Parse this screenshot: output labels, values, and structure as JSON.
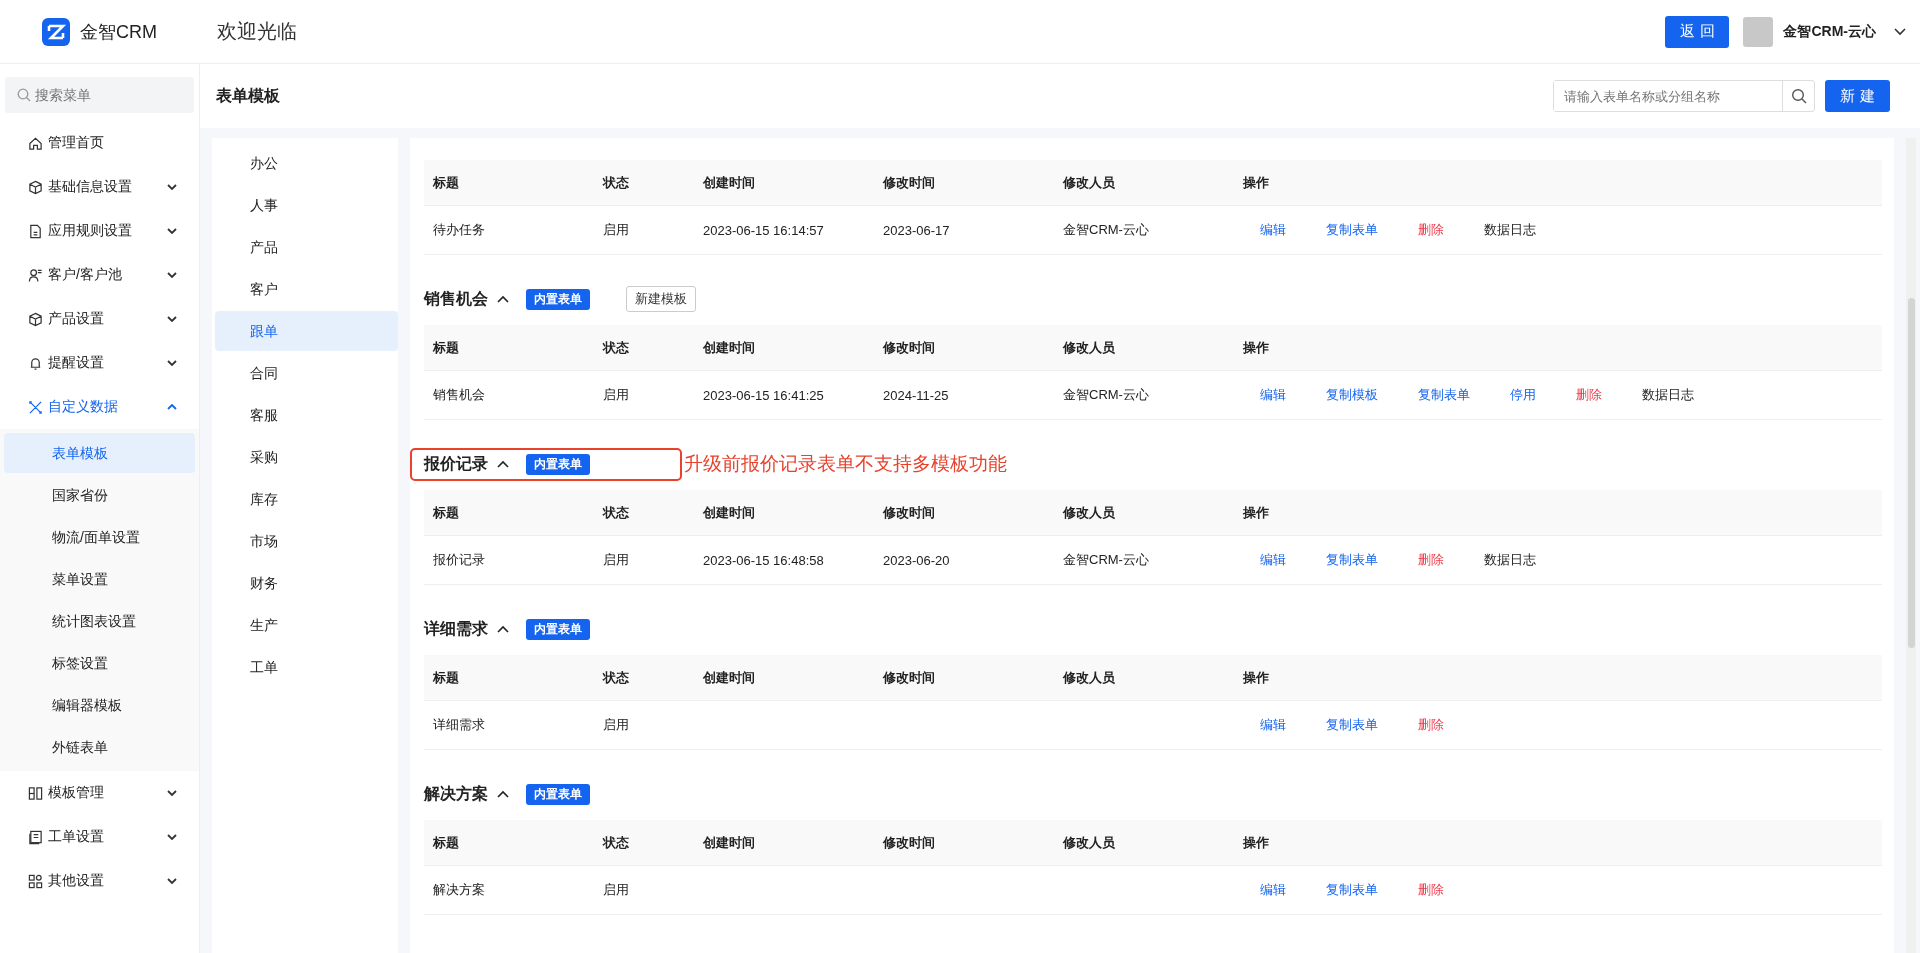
{
  "header": {
    "logo_text": "金智CRM",
    "welcome": "欢迎光临",
    "back_button": "返 回",
    "user_name": "金智CRM-云心"
  },
  "sidebar": {
    "search_placeholder": "搜索菜单",
    "items": [
      {
        "label": "管理首页"
      },
      {
        "label": "基础信息设置",
        "expanded": false
      },
      {
        "label": "应用规则设置",
        "expanded": false
      },
      {
        "label": "客户/客户池",
        "expanded": false
      },
      {
        "label": "产品设置",
        "expanded": false
      },
      {
        "label": "提醒设置",
        "expanded": false
      },
      {
        "label": "自定义数据",
        "expanded": true,
        "children": [
          {
            "label": "表单模板",
            "selected": true
          },
          {
            "label": "国家省份",
            "selected": false
          },
          {
            "label": "物流/面单设置",
            "selected": false
          },
          {
            "label": "菜单设置",
            "selected": false
          },
          {
            "label": "统计图表设置",
            "selected": false
          },
          {
            "label": "标签设置",
            "selected": false
          },
          {
            "label": "编辑器模板",
            "selected": false
          },
          {
            "label": "外链表单",
            "selected": false
          }
        ]
      },
      {
        "label": "模板管理",
        "expanded": false
      },
      {
        "label": "工单设置",
        "expanded": false
      },
      {
        "label": "其他设置",
        "expanded": false
      }
    ]
  },
  "page": {
    "title": "表单模板",
    "search_placeholder": "请输入表单名称或分组名称",
    "new_button": "新 建"
  },
  "categories": [
    {
      "label": "办公",
      "selected": false
    },
    {
      "label": "人事",
      "selected": false
    },
    {
      "label": "产品",
      "selected": false
    },
    {
      "label": "客户",
      "selected": false
    },
    {
      "label": "跟单",
      "selected": true
    },
    {
      "label": "合同",
      "selected": false
    },
    {
      "label": "客服",
      "selected": false
    },
    {
      "label": "采购",
      "selected": false
    },
    {
      "label": "库存",
      "selected": false
    },
    {
      "label": "市场",
      "selected": false
    },
    {
      "label": "财务",
      "selected": false
    },
    {
      "label": "生产",
      "selected": false
    },
    {
      "label": "工单",
      "selected": false
    }
  ],
  "sections": [
    {
      "columns": [
        "标题",
        "状态",
        "创建时间",
        "修改时间",
        "修改人员",
        "操作"
      ],
      "rows": [
        {
          "title": "待办任务",
          "status": "启用",
          "created": "2023-06-15 16:14:57",
          "modified": "2023-06-17",
          "modifier": "金智CRM-云心",
          "actions": [
            {
              "label": "编辑",
              "kind": "link"
            },
            {
              "label": "复制表单",
              "kind": "link"
            },
            {
              "label": "删除",
              "kind": "danger"
            },
            {
              "label": "数据日志",
              "kind": "plain"
            }
          ]
        }
      ]
    },
    {
      "name": "销售机会",
      "badge": "内置表单",
      "template_button": "新建模板",
      "highlighted": false,
      "columns": [
        "标题",
        "状态",
        "创建时间",
        "修改时间",
        "修改人员",
        "操作"
      ],
      "rows": [
        {
          "title": "销售机会",
          "status": "启用",
          "created": "2023-06-15 16:41:25",
          "modified": "2024-11-25",
          "modifier": "金智CRM-云心",
          "actions": [
            {
              "label": "编辑",
              "kind": "link"
            },
            {
              "label": "复制模板",
              "kind": "link"
            },
            {
              "label": "复制表单",
              "kind": "link"
            },
            {
              "label": "停用",
              "kind": "link"
            },
            {
              "label": "删除",
              "kind": "danger"
            },
            {
              "label": "数据日志",
              "kind": "plain"
            }
          ]
        }
      ]
    },
    {
      "name": "报价记录",
      "badge": "内置表单",
      "highlighted": true,
      "annotation": "升级前报价记录表单不支持多模板功能",
      "columns": [
        "标题",
        "状态",
        "创建时间",
        "修改时间",
        "修改人员",
        "操作"
      ],
      "rows": [
        {
          "title": "报价记录",
          "status": "启用",
          "created": "2023-06-15 16:48:58",
          "modified": "2023-06-20",
          "modifier": "金智CRM-云心",
          "actions": [
            {
              "label": "编辑",
              "kind": "link"
            },
            {
              "label": "复制表单",
              "kind": "link"
            },
            {
              "label": "删除",
              "kind": "danger"
            },
            {
              "label": "数据日志",
              "kind": "plain"
            }
          ]
        }
      ]
    },
    {
      "name": "详细需求",
      "badge": "内置表单",
      "highlighted": false,
      "columns": [
        "标题",
        "状态",
        "创建时间",
        "修改时间",
        "修改人员",
        "操作"
      ],
      "rows": [
        {
          "title": "详细需求",
          "status": "启用",
          "actions": [
            {
              "label": "编辑",
              "kind": "link"
            },
            {
              "label": "复制表单",
              "kind": "link"
            },
            {
              "label": "删除",
              "kind": "danger"
            }
          ]
        }
      ]
    },
    {
      "name": "解决方案",
      "badge": "内置表单",
      "highlighted": false,
      "columns": [
        "标题",
        "状态",
        "创建时间",
        "修改时间",
        "修改人员",
        "操作"
      ],
      "rows": [
        {
          "title": "解决方案",
          "status": "启用",
          "actions": [
            {
              "label": "编辑",
              "kind": "link"
            },
            {
              "label": "复制表单",
              "kind": "link"
            },
            {
              "label": "删除",
              "kind": "danger"
            }
          ]
        }
      ]
    }
  ]
}
